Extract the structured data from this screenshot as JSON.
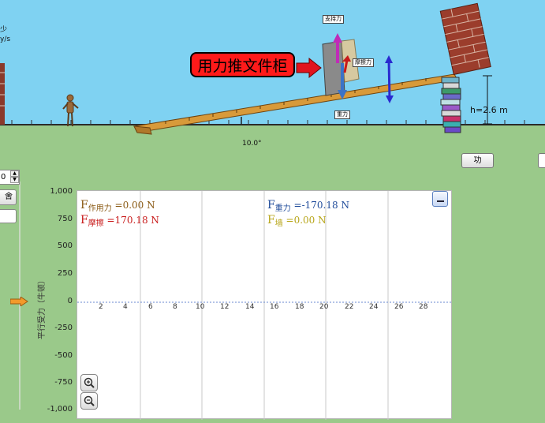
{
  "scene": {
    "push_callout": "用力推文件柜",
    "label_support_force": "支持力",
    "label_friction": "摩擦力",
    "label_gravity": "重力",
    "height_readout": "h=2.6 m",
    "angle_readout": "10.0°",
    "left_cut_text_1": "少",
    "left_cut_text_2": "y/s"
  },
  "controls": {
    "spinner_value": "0",
    "left_button_cut": "舍",
    "work_button": "功"
  },
  "graph": {
    "y_axis_title": "平行受力（牛顿）",
    "y_ticks": [
      "1,000",
      "750",
      "500",
      "250",
      "0",
      "-250",
      "-500",
      "-750",
      "-1,000"
    ],
    "x_ticks": [
      "2",
      "4",
      "6",
      "8",
      "10",
      "12",
      "14",
      "16",
      "18",
      "20",
      "22",
      "24",
      "26",
      "28"
    ],
    "legend": {
      "applied": {
        "f": "F",
        "sub": "作用力",
        "value": "=0.00 N",
        "color": "#8a5a14"
      },
      "friction": {
        "f": "F",
        "sub": "摩擦",
        "value": "=170.18 N",
        "color": "#c81a1a"
      },
      "gravity": {
        "f": "F",
        "sub": "重力",
        "value": "=-170.18 N",
        "color": "#1f4b9a"
      },
      "wall": {
        "f": "F",
        "sub": "墙",
        "value": "=0.00 N",
        "color": "#b8a61a"
      }
    },
    "zoom_in_icon": "+",
    "zoom_out_icon": "-"
  }
}
